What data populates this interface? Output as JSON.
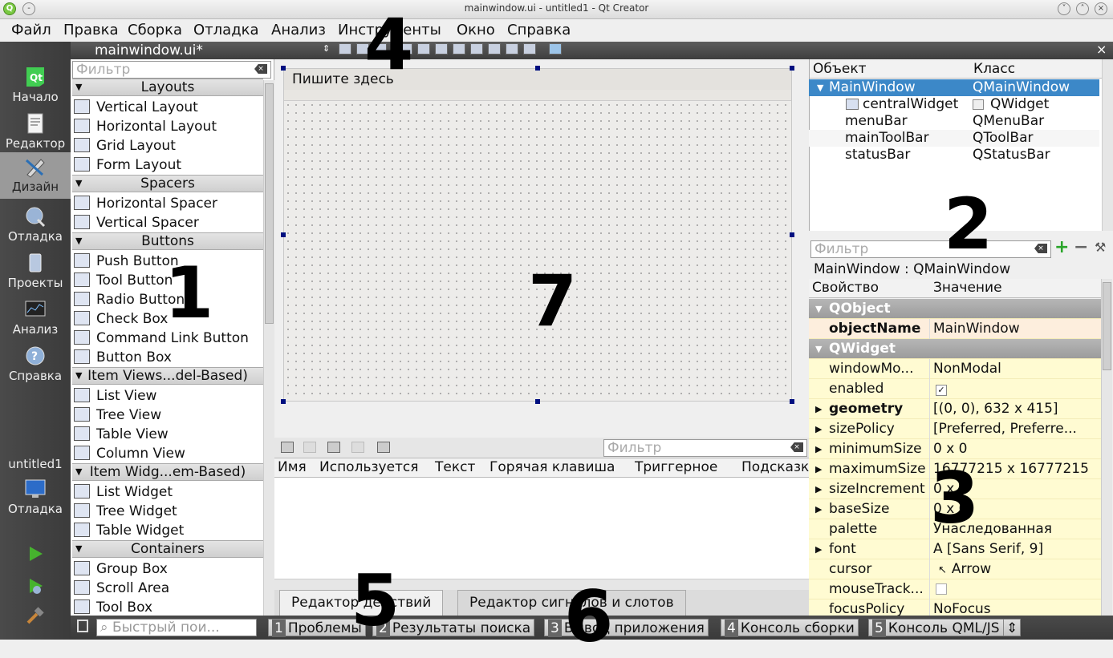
{
  "window": {
    "title": "mainwindow.ui - untitled1 - Qt Creator"
  },
  "menu": [
    "Файл",
    "Правка",
    "Сборка",
    "Отладка",
    "Анализ",
    "Инструменты",
    "Окно",
    "Справка"
  ],
  "modes": [
    {
      "label": "Начало",
      "icon": "qt-logo-icon"
    },
    {
      "label": "Редактор",
      "icon": "editor-icon"
    },
    {
      "label": "Дизайн",
      "icon": "design-icon"
    },
    {
      "label": "Отладка",
      "icon": "debug-icon"
    },
    {
      "label": "Проекты",
      "icon": "projects-icon"
    },
    {
      "label": "Анализ",
      "icon": "analyze-icon"
    },
    {
      "label": "Справка",
      "icon": "help-icon"
    }
  ],
  "kit": {
    "project": "untitled1",
    "label": "Отладка"
  },
  "document": {
    "name": "mainwindow.ui*"
  },
  "widgetbox": {
    "filter_placeholder": "Фильтр",
    "categories": [
      {
        "name": "Layouts",
        "items": [
          "Vertical Layout",
          "Horizontal Layout",
          "Grid Layout",
          "Form Layout"
        ]
      },
      {
        "name": "Spacers",
        "items": [
          "Horizontal Spacer",
          "Vertical Spacer"
        ]
      },
      {
        "name": "Buttons",
        "items": [
          "Push Button",
          "Tool Button",
          "Radio Button",
          "Check Box",
          "Command Link Button",
          "Button Box"
        ]
      },
      {
        "name": "Item Views...del-Based)",
        "items": [
          "List View",
          "Tree View",
          "Table View",
          "Column View"
        ]
      },
      {
        "name": "Item Widg...em-Based)",
        "items": [
          "List Widget",
          "Tree Widget",
          "Table Widget"
        ]
      },
      {
        "name": "Containers",
        "items": [
          "Group Box",
          "Scroll Area",
          "Tool Box"
        ]
      }
    ]
  },
  "form": {
    "menu_placeholder": "Пишите здесь"
  },
  "actions": {
    "filter_placeholder": "Фильтр",
    "columns": [
      "Имя",
      "Используется",
      "Текст",
      "Горячая клавиша",
      "Триггерное",
      "Подсказка"
    ],
    "tabs": [
      "Редактор действий",
      "Редактор сигналов и слотов"
    ]
  },
  "object_inspector": {
    "columns": [
      "Объект",
      "Класс"
    ],
    "rows": [
      {
        "object": "MainWindow",
        "class": "QMainWindow"
      },
      {
        "object": "centralWidget",
        "class": "QWidget"
      },
      {
        "object": "menuBar",
        "class": "QMenuBar"
      },
      {
        "object": "mainToolBar",
        "class": "QToolBar"
      },
      {
        "object": "statusBar",
        "class": "QStatusBar"
      }
    ]
  },
  "property_editor": {
    "filter_placeholder": "Фильтр",
    "class_label": "MainWindow : QMainWindow",
    "columns": [
      "Свойство",
      "Значение"
    ],
    "rows": [
      {
        "group": true,
        "name": "QObject"
      },
      {
        "name": "objectName",
        "value": "MainWindow",
        "bold": true
      },
      {
        "group": true,
        "name": "QWidget"
      },
      {
        "name": "windowMo...",
        "value": "NonModal"
      },
      {
        "name": "enabled",
        "value": "✓"
      },
      {
        "name": "geometry",
        "value": "[(0, 0), 632 x 415]",
        "bold": true,
        "expand": true
      },
      {
        "name": "sizePolicy",
        "value": "[Preferred, Preferre...",
        "expand": true
      },
      {
        "name": "minimumSize",
        "value": "0 x 0",
        "expand": true
      },
      {
        "name": "maximumSize",
        "value": "16777215 x 16777215",
        "expand": true
      },
      {
        "name": "sizeIncrement",
        "value": "0 x 0",
        "expand": true
      },
      {
        "name": "baseSize",
        "value": "0 x 0",
        "expand": true
      },
      {
        "name": "palette",
        "value": "Унаследованная"
      },
      {
        "name": "font",
        "value": "A [Sans Serif, 9]",
        "expand": true
      },
      {
        "name": "cursor",
        "value": "Arrow"
      },
      {
        "name": "mouseTrack...",
        "value": ""
      },
      {
        "name": "focusPolicy",
        "value": "NoFocus"
      }
    ]
  },
  "statusbar": {
    "search_placeholder": "Быстрый пои...",
    "panes": [
      {
        "n": "1",
        "label": "Проблемы"
      },
      {
        "n": "2",
        "label": "Результаты поиска"
      },
      {
        "n": "3",
        "label": "Вывод приложения"
      },
      {
        "n": "4",
        "label": "Консоль сборки"
      },
      {
        "n": "5",
        "label": "Консоль QML/JS"
      }
    ]
  },
  "annotations": [
    "1",
    "2",
    "3",
    "4",
    "5",
    "6",
    "7"
  ]
}
